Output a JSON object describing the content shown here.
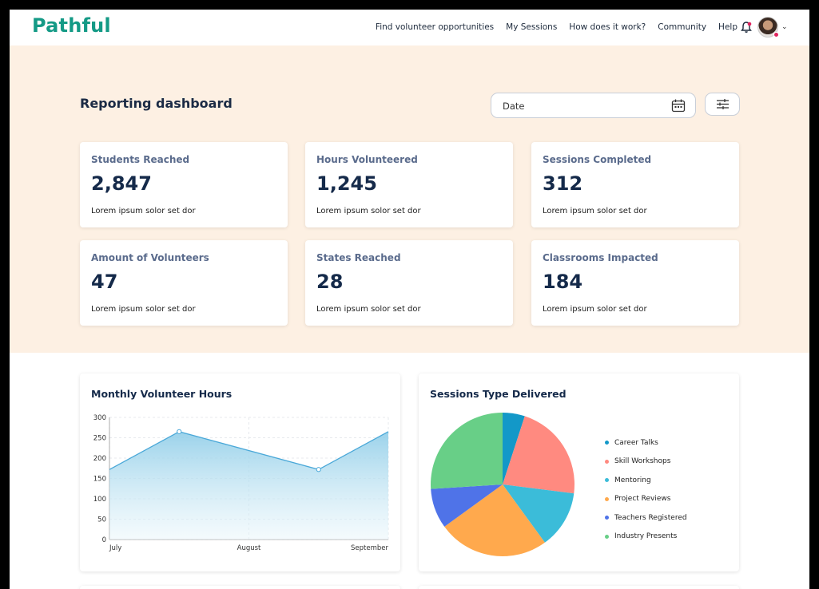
{
  "app": {
    "logo": "Pathful",
    "brand_color": "#149a86"
  },
  "nav": {
    "links": [
      "Find volunteer opportunities",
      "My Sessions",
      "How does it work?",
      "Community",
      "Help"
    ]
  },
  "page": {
    "title": "Reporting dashboard"
  },
  "date_filter": {
    "label": "Date"
  },
  "stats": [
    {
      "label": "Students Reached",
      "value": "2,847",
      "sub": "Lorem ipsum solor set dor"
    },
    {
      "label": "Hours Volunteered",
      "value": "1,245",
      "sub": "Lorem ipsum solor set dor"
    },
    {
      "label": "Sessions Completed",
      "value": "312",
      "sub": "Lorem ipsum solor set dor"
    },
    {
      "label": "Amount of Volunteers",
      "value": "47",
      "sub": "Lorem ipsum solor set dor"
    },
    {
      "label": "States Reached",
      "value": "28",
      "sub": "Lorem ipsum solor set dor"
    },
    {
      "label": "Classrooms Impacted",
      "value": "184",
      "sub": "Lorem ipsum solor set dor"
    }
  ],
  "chart_data": [
    {
      "type": "area",
      "title": "Monthly Volunteer Hours",
      "x_ticks": [
        "July",
        "August",
        "September"
      ],
      "y_ticks": [
        0,
        50,
        100,
        150,
        200,
        250,
        300
      ],
      "ylim": [
        0,
        300
      ],
      "x": [
        0,
        0.5,
        1.5,
        2
      ],
      "values": [
        172,
        265,
        172,
        265
      ],
      "color": "#4aa8d8",
      "grid": true
    },
    {
      "type": "pie",
      "title": "Sessions Type Delivered",
      "legend_position": "right",
      "series": [
        {
          "name": "Career Talks",
          "value": 5,
          "color": "#1398c8"
        },
        {
          "name": "Skill Workshops",
          "value": 22,
          "color": "#ff8a80"
        },
        {
          "name": "Mentoring",
          "value": 13,
          "color": "#3bbcd9"
        },
        {
          "name": "Project Reviews",
          "value": 25,
          "color": "#ffa94d"
        },
        {
          "name": "Teachers Registered",
          "value": 9,
          "color": "#4f73e8"
        },
        {
          "name": "Industry Presents",
          "value": 26,
          "color": "#68cf87"
        }
      ]
    }
  ]
}
